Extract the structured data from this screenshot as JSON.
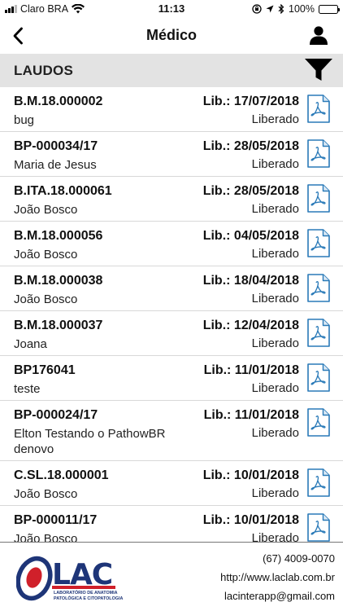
{
  "status_bar": {
    "carrier": "Claro BRA",
    "time": "11:13",
    "battery": "100%",
    "battery_level": 1.0
  },
  "nav": {
    "title": "Médico",
    "back_icon": "chevron-left-icon",
    "user_icon": "user-icon"
  },
  "section": {
    "title": "LAUDOS",
    "filter_icon": "filter-icon"
  },
  "laudos": [
    {
      "code": "B.M.18.000002",
      "patient": "bug",
      "date": "Lib.: 17/07/2018",
      "status": "Liberado"
    },
    {
      "code": "BP-000034/17",
      "patient": "Maria de Jesus",
      "date": "Lib.: 28/05/2018",
      "status": "Liberado"
    },
    {
      "code": "B.ITA.18.000061",
      "patient": "João Bosco",
      "date": "Lib.: 28/05/2018",
      "status": "Liberado"
    },
    {
      "code": "B.M.18.000056",
      "patient": "João Bosco",
      "date": "Lib.: 04/05/2018",
      "status": "Liberado"
    },
    {
      "code": "B.M.18.000038",
      "patient": "João Bosco",
      "date": "Lib.: 18/04/2018",
      "status": "Liberado"
    },
    {
      "code": "B.M.18.000037",
      "patient": "Joana",
      "date": "Lib.: 12/04/2018",
      "status": "Liberado"
    },
    {
      "code": "BP176041",
      "patient": "teste",
      "date": "Lib.: 11/01/2018",
      "status": "Liberado"
    },
    {
      "code": "BP-000024/17",
      "patient": "Elton Testando o PathowBR denovo",
      "date": "Lib.: 11/01/2018",
      "status": "Liberado"
    },
    {
      "code": "C.SL.18.000001",
      "patient": "João Bosco",
      "date": "Lib.: 10/01/2018",
      "status": "Liberado"
    },
    {
      "code": "BP-000011/17",
      "patient": "João Bosco",
      "date": "Lib.: 10/01/2018",
      "status": "Liberado"
    }
  ],
  "footer": {
    "logo_text": "LAC",
    "logo_subtitle_1": "LABORATÓRIO DE ANATOMIA",
    "logo_subtitle_2": "PATOLÓGICA E CITOPATOLOGIA",
    "phone": "(67) 4009-0070",
    "website": "http://www.laclab.com.br",
    "email": "lacinterapp@gmail.com"
  },
  "colors": {
    "header_bg": "#e3e3e3",
    "pdf_icon": "#2a7ab8",
    "battery": "#2fbe3f",
    "logo_blue": "#1e3578",
    "logo_red": "#d0202a"
  }
}
